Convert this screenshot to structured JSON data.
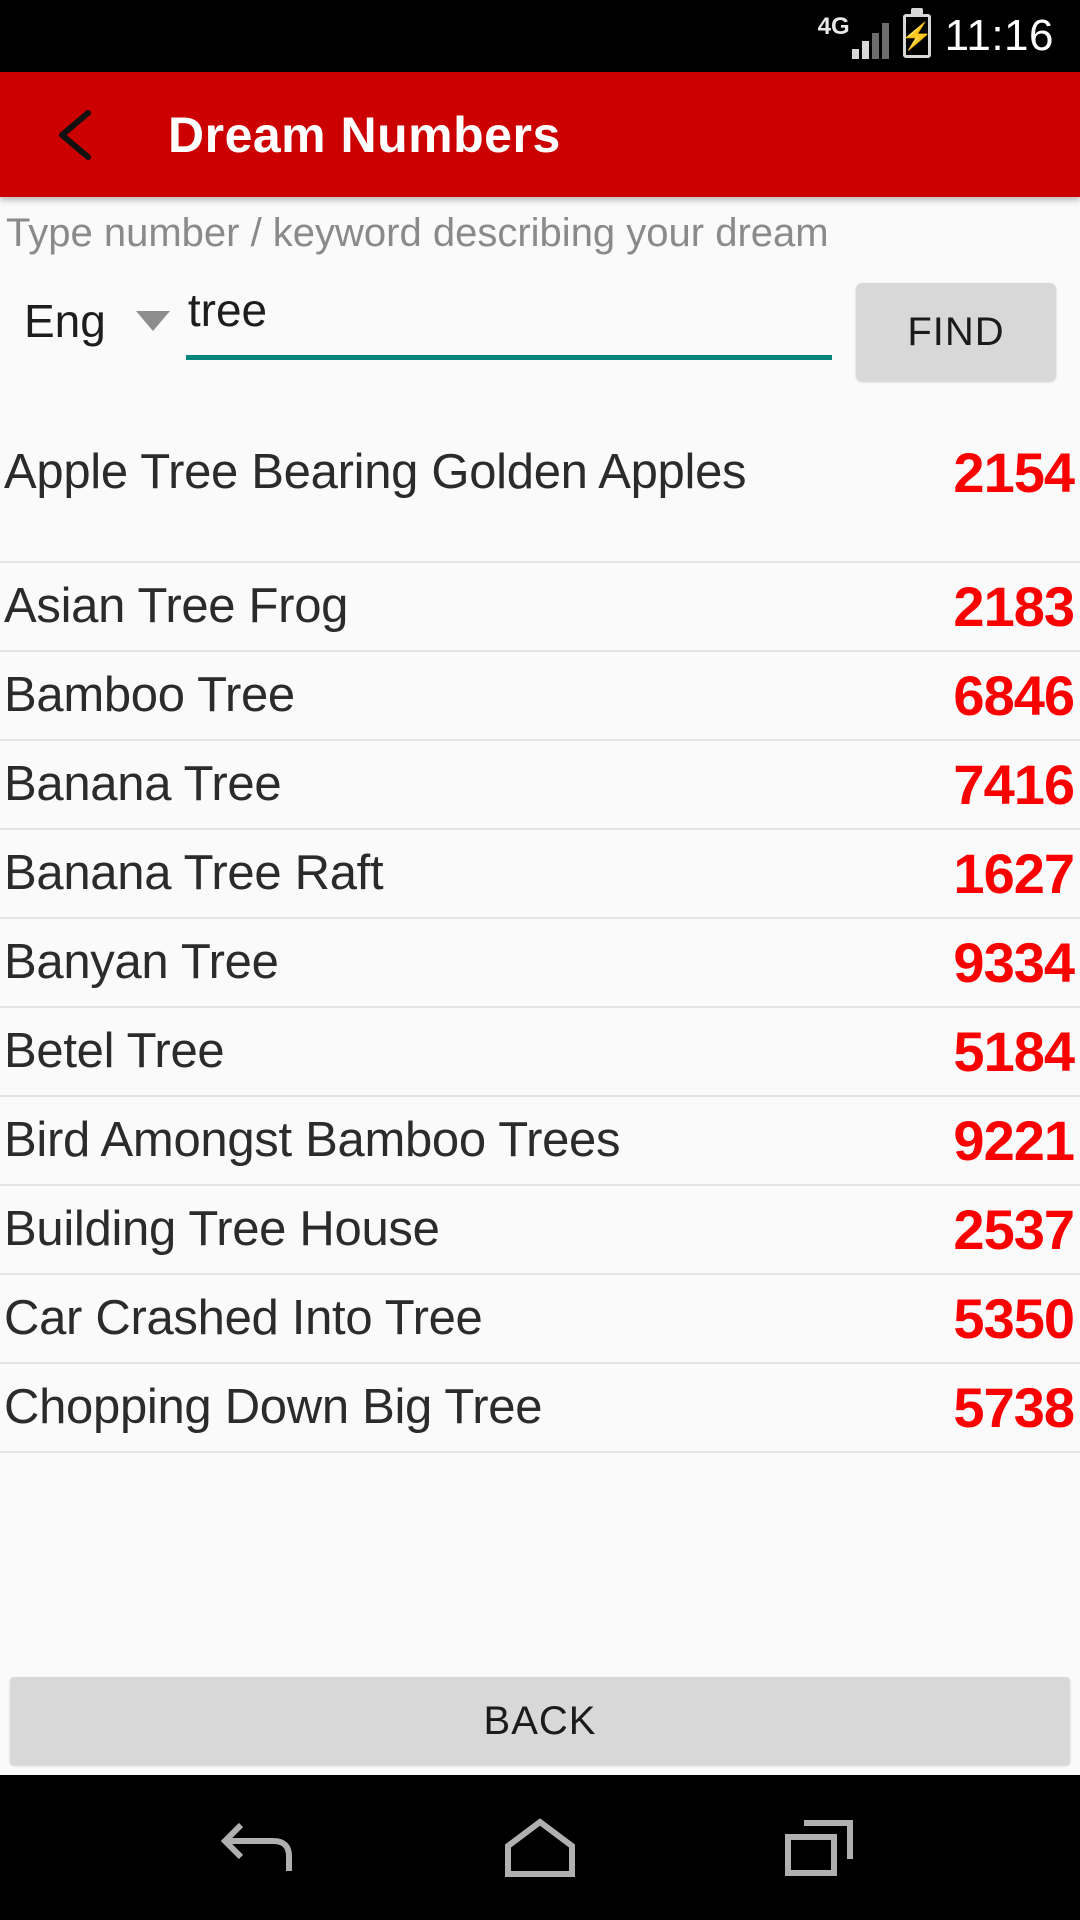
{
  "status_bar": {
    "network_type": "4G",
    "battery_icon": "battery-charging-icon",
    "time": "11:16"
  },
  "app_bar": {
    "back_icon": "arrow-left-icon",
    "title": "Dream Numbers"
  },
  "search": {
    "hint": "Type number / keyword describing your dream",
    "language_selected": "Eng",
    "language_caret_icon": "chevron-down-icon",
    "query_value": "tree",
    "query_placeholder": "",
    "find_label": "FIND",
    "underline_color": "#00857a"
  },
  "results": [
    {
      "label": "Apple Tree Bearing Golden Apples",
      "number": "2154"
    },
    {
      "label": "Asian Tree Frog",
      "number": "2183"
    },
    {
      "label": "Bamboo Tree",
      "number": "6846"
    },
    {
      "label": "Banana Tree",
      "number": "7416"
    },
    {
      "label": "Banana Tree Raft",
      "number": "1627"
    },
    {
      "label": "Banyan Tree",
      "number": "9334"
    },
    {
      "label": "Betel Tree",
      "number": "5184"
    },
    {
      "label": "Bird Amongst Bamboo Trees",
      "number": "9221"
    },
    {
      "label": "Building Tree House",
      "number": "2537"
    },
    {
      "label": "Car Crashed Into Tree",
      "number": "5350"
    },
    {
      "label": "Chopping Down Big Tree",
      "number": "5738"
    }
  ],
  "footer": {
    "back_label": "BACK"
  },
  "nav_bar": {
    "back_icon": "nav-back-icon",
    "home_icon": "nav-home-icon",
    "recents_icon": "nav-recents-icon"
  },
  "colors": {
    "app_bar": "#cc0000",
    "number": "#fb0000",
    "accent_underline": "#00857a",
    "button": "#d8d8d8"
  }
}
